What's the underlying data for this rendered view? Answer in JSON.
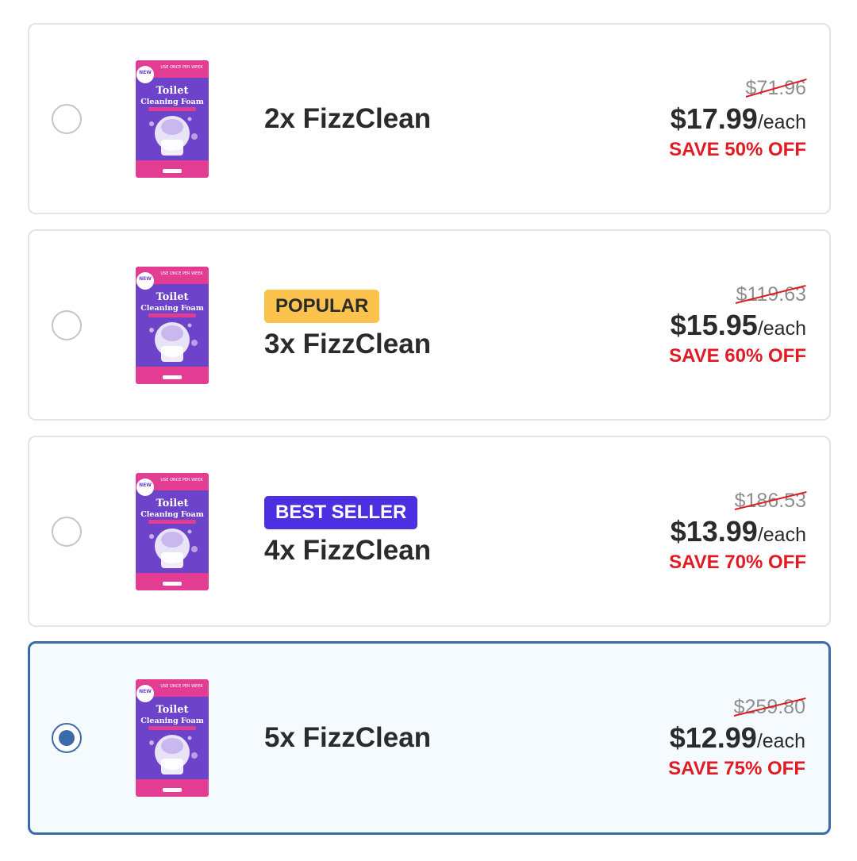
{
  "colors": {
    "accent": "#3a6aa8",
    "save_red": "#e01b24",
    "popular_badge": "#fbc34d",
    "best_seller_badge": "#4b2fe0",
    "package_pink": "#e23d93",
    "package_purple": "#6d43c9"
  },
  "package_art": {
    "top_text": "USE ONCE PER WEEK",
    "new_sticker": "NEW",
    "title_line1": "Toilet",
    "title_line2": "Cleaning Foam"
  },
  "offers": [
    {
      "name": "2x FizzClean",
      "badge": "",
      "old_price": "$71.96",
      "price": "$17.99",
      "per": "/each",
      "save": "SAVE 50% OFF",
      "selected": false
    },
    {
      "name": "3x FizzClean",
      "badge": "POPULAR",
      "old_price": "$119.63",
      "price": "$15.95",
      "per": "/each",
      "save": "SAVE 60% OFF",
      "selected": false
    },
    {
      "name": "4x FizzClean",
      "badge": "BEST SELLER",
      "old_price": "$186.53",
      "price": "$13.99",
      "per": "/each",
      "save": "SAVE 70% OFF",
      "selected": false
    },
    {
      "name": "5x FizzClean",
      "badge": "",
      "old_price": "$259.80",
      "price": "$12.99",
      "per": "/each",
      "save": "SAVE 75% OFF",
      "selected": true
    }
  ]
}
